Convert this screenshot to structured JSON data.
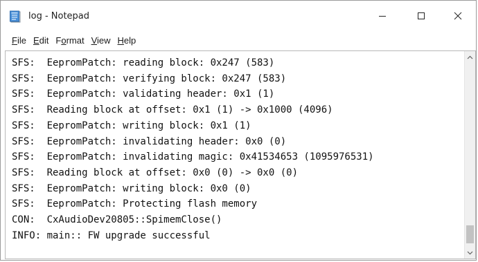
{
  "window": {
    "title": "log - Notepad",
    "controls": {
      "minimize": "minimize-icon",
      "maximize": "maximize-icon",
      "close": "close-icon"
    }
  },
  "menu": [
    {
      "accel": "F",
      "rest": "ile"
    },
    {
      "accel": "E",
      "rest": "dit"
    },
    {
      "accel": "o",
      "pre": "F",
      "rest": "rmat"
    },
    {
      "accel": "V",
      "rest": "iew"
    },
    {
      "accel": "H",
      "rest": "elp"
    }
  ],
  "log_lines": [
    "SFS:  EepromPatch: reading block: 0x247 (583)",
    "SFS:  EepromPatch: verifying block: 0x247 (583)",
    "SFS:  EepromPatch: validating header: 0x1 (1)",
    "SFS:  Reading block at offset: 0x1 (1) -> 0x1000 (4096)",
    "SFS:  EepromPatch: writing block: 0x1 (1)",
    "SFS:  EepromPatch: invalidating header: 0x0 (0)",
    "SFS:  EepromPatch: invalidating magic: 0x41534653 (1095976531)",
    "SFS:  Reading block at offset: 0x0 (0) -> 0x0 (0)",
    "SFS:  EepromPatch: writing block: 0x0 (0)",
    "SFS:  EepromPatch: Protecting flash memory",
    "CON:  CxAudioDev20805::SpimemClose()",
    "INFO: main:: FW upgrade successful"
  ],
  "colors": {
    "icon_blue": "#4a90d9",
    "text": "#111111",
    "scrollbar_track": "#f0f0f0",
    "scrollbar_thumb": "#c2c2c2"
  }
}
